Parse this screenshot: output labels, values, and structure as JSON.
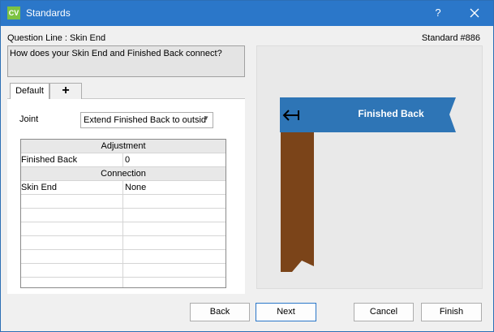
{
  "window": {
    "app_icon": "CV",
    "title": "Standards",
    "help_label": "?"
  },
  "header": {
    "question_line": "Question Line : Skin End",
    "standard_number": "Standard #886"
  },
  "question": {
    "text": "How does your Skin End and Finished Back connect?"
  },
  "tabs": [
    {
      "label": "Default",
      "active": true
    },
    {
      "label": "+",
      "icon": "plus-icon"
    }
  ],
  "joint": {
    "label": "Joint",
    "selected_value": "Extend Finished Back to outsid"
  },
  "grid": {
    "sections": [
      {
        "header": "Adjustment",
        "rows": [
          {
            "name": "Finished Back",
            "value": "0"
          }
        ]
      },
      {
        "header": "Connection",
        "rows": [
          {
            "name": "Skin End",
            "value": "None"
          }
        ]
      }
    ]
  },
  "preview": {
    "label": "Finished Back",
    "colors": {
      "banner": "#2e75b6",
      "skin_end": "#7b4419",
      "background": "#e9e9e9"
    },
    "arrow_icon": "arrow-left-bar-icon"
  },
  "buttons": {
    "back": "Back",
    "next": "Next",
    "cancel": "Cancel",
    "finish": "Finish"
  }
}
